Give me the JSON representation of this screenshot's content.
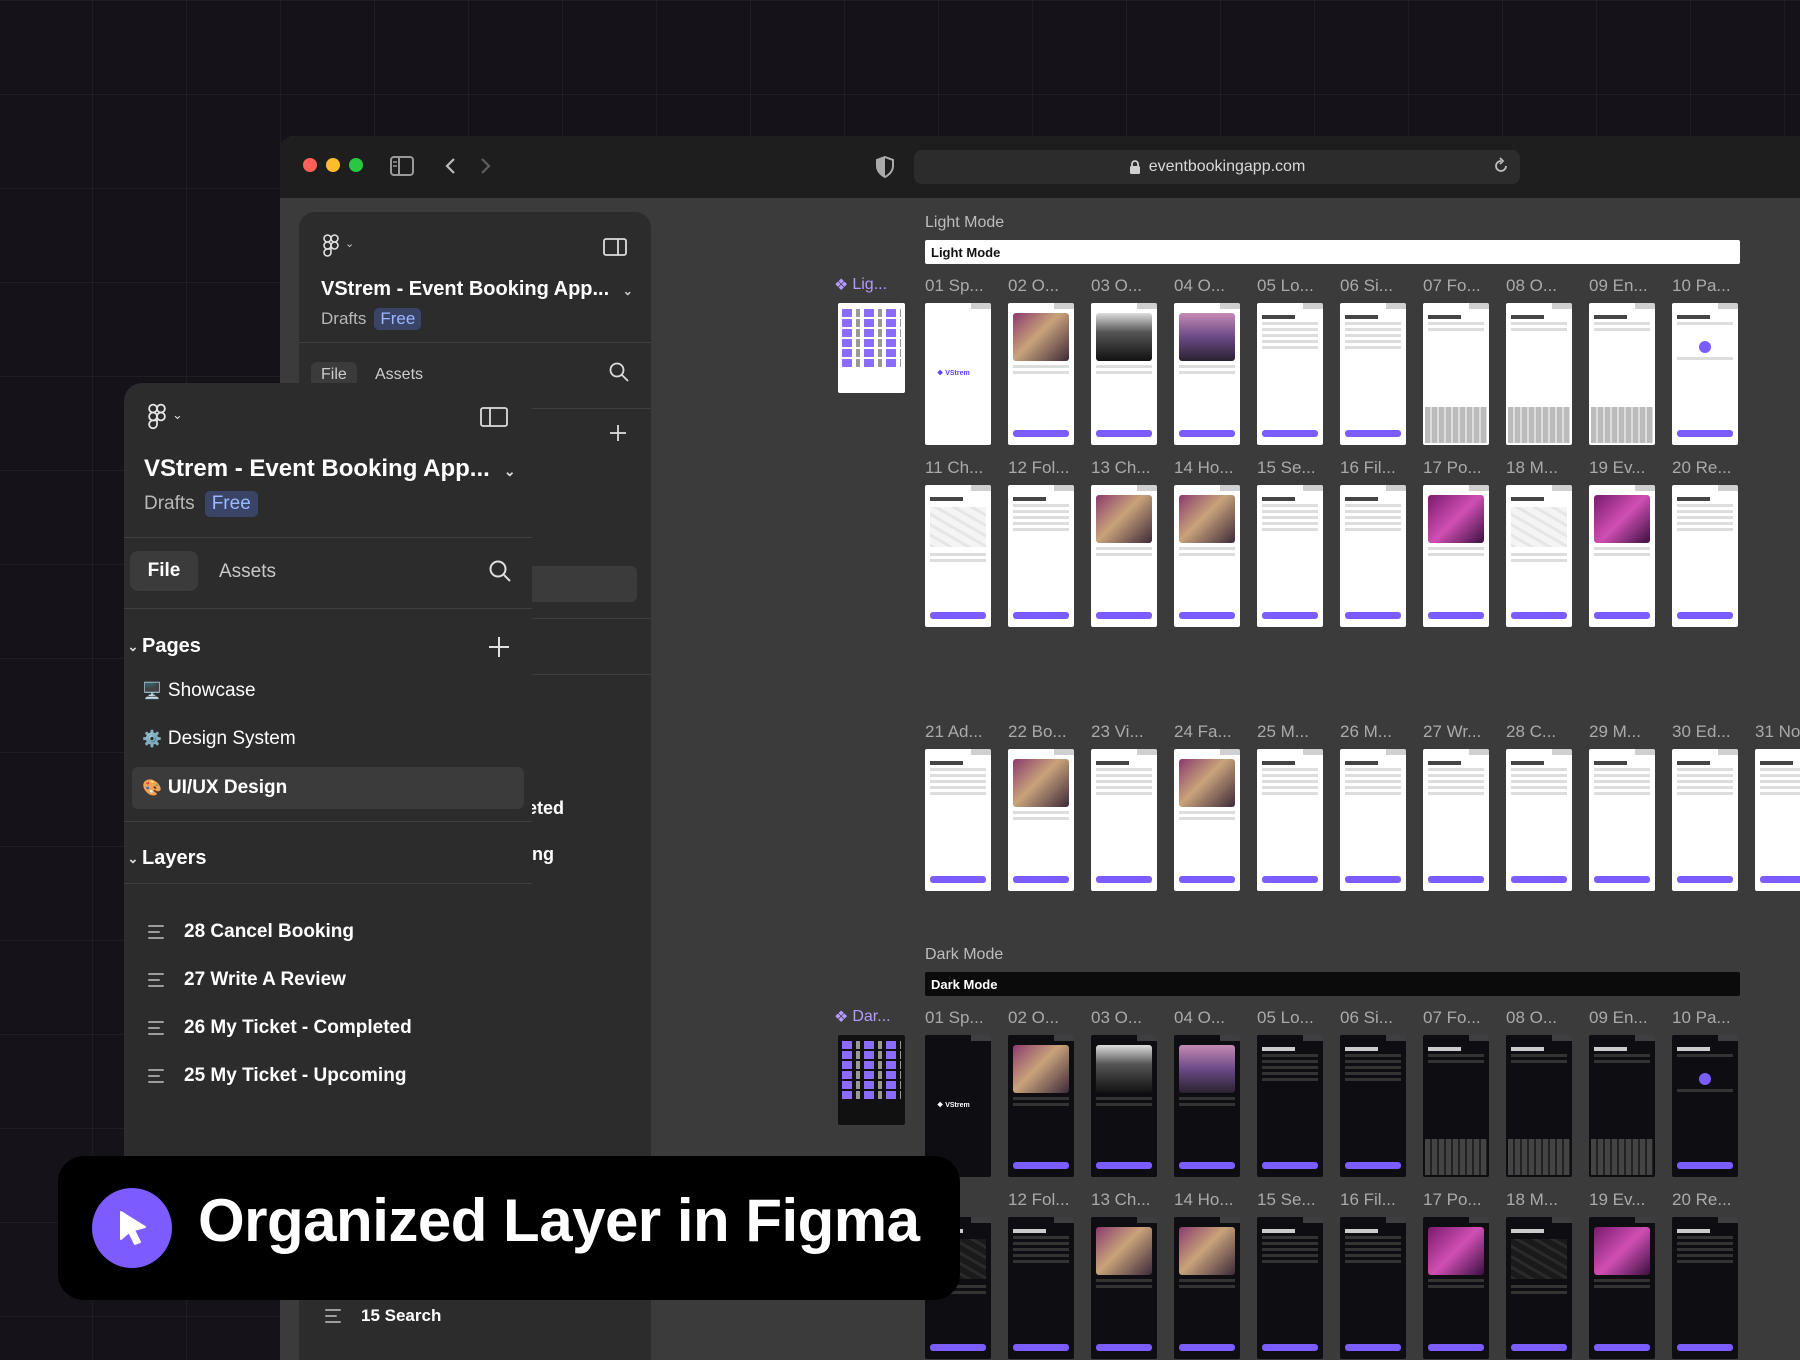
{
  "browser": {
    "url": "eventbookingapp.com"
  },
  "back_panel": {
    "title": "VStrem - Event Booking App...",
    "drafts": "Drafts",
    "plan_badge": "Free",
    "tabs": [
      "File",
      "Assets"
    ],
    "clipped_rows": [
      "eted",
      "ing"
    ]
  },
  "front_panel": {
    "title": "VStrem - Event Booking App...",
    "drafts": "Drafts",
    "plan_badge": "Free",
    "tabs": {
      "file": "File",
      "assets": "Assets"
    },
    "pages_header": "Pages",
    "pages": [
      {
        "emoji": "🖥️",
        "label": "Showcase"
      },
      {
        "emoji": "⚙️",
        "label": "Design System"
      },
      {
        "emoji": "🎨",
        "label": "UI/UX Design"
      }
    ],
    "layers_header": "Layers",
    "layers": [
      "28 Cancel Booking",
      "27 Write A Review",
      "26 My Ticket - Completed",
      "25 My Ticket - Upcoming"
    ],
    "peek_layer": "15 Search"
  },
  "canvas": {
    "light": {
      "section_label": "Light Mode",
      "bar_label": "Light Mode",
      "component_label": "Lig...",
      "row1": [
        "01 Sp...",
        "02 O...",
        "03 O...",
        "04 O...",
        "05 Lo...",
        "06 Si...",
        "07 Fo...",
        "08 O...",
        "09 En...",
        "10 Pa..."
      ],
      "row2": [
        "11 Ch...",
        "12 Fol...",
        "13 Ch...",
        "14 Ho...",
        "15 Se...",
        "16 Fil...",
        "17 Po...",
        "18 M...",
        "19 Ev...",
        "20 Re..."
      ],
      "row3": [
        "21 Ad...",
        "22 Bo...",
        "23 Vi...",
        "24 Fa...",
        "25 M...",
        "26 M...",
        "27 Wr...",
        "28 C...",
        "29 M...",
        "30 Ed...",
        "31 No"
      ]
    },
    "dark": {
      "section_label": "Dark Mode",
      "bar_label": "Dark Mode",
      "component_label": "Dar...",
      "row1": [
        "01 Sp...",
        "02 O...",
        "03 O...",
        "04 O...",
        "05 Lo...",
        "06 Si...",
        "07 Fo...",
        "08 O...",
        "09 En...",
        "10 Pa..."
      ],
      "row2": [
        "h...",
        "12 Fol...",
        "13 Ch...",
        "14 Ho...",
        "15 Se...",
        "16 Fil...",
        "17 Po...",
        "18 M...",
        "19 Ev...",
        "20 Re..."
      ]
    },
    "brand_logo": "VStrem"
  },
  "banner": {
    "text": "Organized Layer in Figma"
  },
  "colors": {
    "accent": "#7c5cff",
    "badge_bg": "#394467",
    "badge_text": "#9cb8ff",
    "traffic_red": "#fe5f57",
    "traffic_yellow": "#febc2e",
    "traffic_green": "#28c840"
  },
  "icons": [
    "figma-logo-icon",
    "chevron-down-icon",
    "sidebar-toggle-icon",
    "search-icon",
    "plus-icon",
    "back-arrow-icon",
    "forward-arrow-icon",
    "shield-icon",
    "lock-icon",
    "reload-icon",
    "component-icon",
    "cursor-icon",
    "layer-lines-icon"
  ]
}
